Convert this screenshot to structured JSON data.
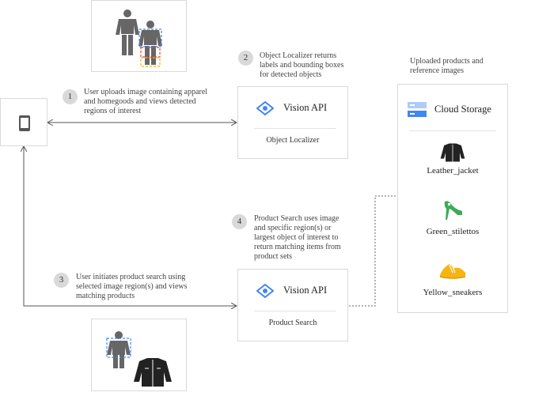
{
  "steps": [
    {
      "num": "1",
      "text": "User uploads image containing apparel and homegoods and views detected regions of interest"
    },
    {
      "num": "2",
      "text": "Object Localizer returns labels and bounding boxes for detected objects"
    },
    {
      "num": "3",
      "text": "User initiates product search using selected image region(s) and views matching products"
    },
    {
      "num": "4",
      "text": "Product Search uses image and specific region(s) or largest object of interest to return matching items from product sets"
    }
  ],
  "vision_api_top": {
    "title": "Vision API",
    "subtitle": "Object Localizer"
  },
  "vision_api_bottom": {
    "title": "Vision API",
    "subtitle": "Product Search"
  },
  "storage": {
    "heading": "Uploaded products and reference images",
    "title": "Cloud Storage",
    "items": [
      {
        "label": "Leather_jacket",
        "icon": "jacket-icon"
      },
      {
        "label": "Green_stilettos",
        "icon": "stiletto-icon"
      },
      {
        "label": "Yellow_sneakers",
        "icon": "sneaker-icon"
      }
    ]
  },
  "colors": {
    "vision_blue": "#4285f4",
    "green": "#3faa57",
    "yellow": "#f6b512",
    "red": "#ea4335",
    "gray_icon": "#666666"
  }
}
